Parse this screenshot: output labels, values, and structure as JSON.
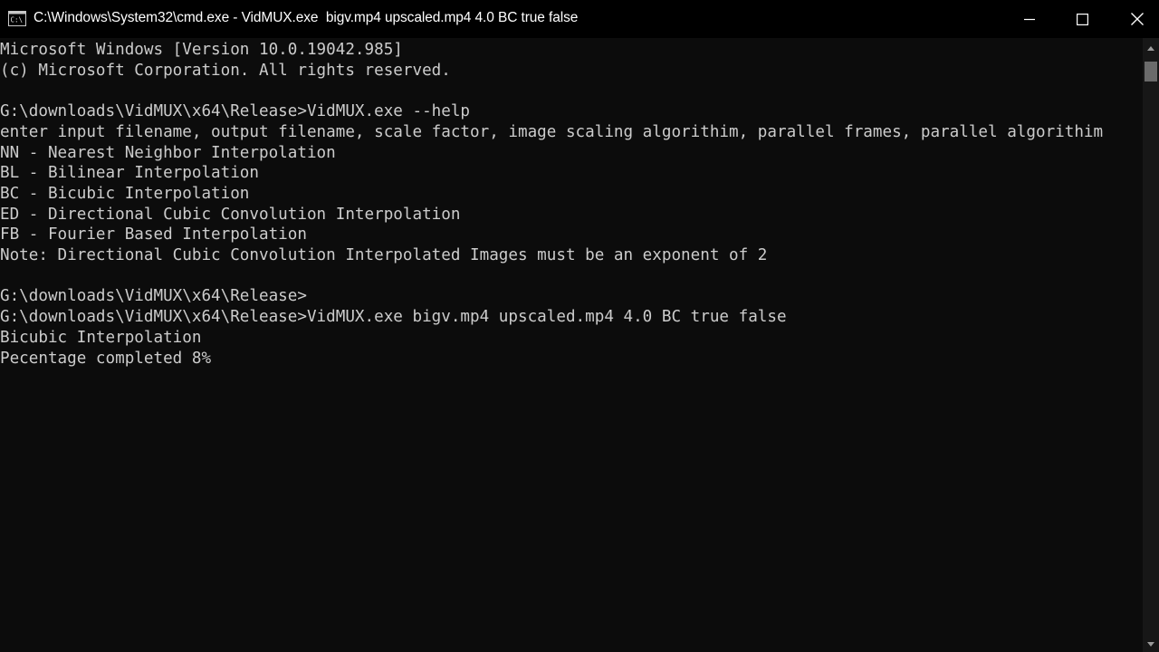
{
  "window": {
    "title": "C:\\Windows\\System32\\cmd.exe - VidMUX.exe  bigv.mp4 upscaled.mp4 4.0 BC true false",
    "icon": "cmd-icon",
    "controls": {
      "minimize_icon": "minimize-icon",
      "maximize_icon": "maximize-icon",
      "close_icon": "close-icon"
    }
  },
  "console": {
    "lines": [
      "Microsoft Windows [Version 10.0.19042.985]",
      "(c) Microsoft Corporation. All rights reserved.",
      "",
      "G:\\downloads\\VidMUX\\x64\\Release>VidMUX.exe --help",
      "enter input filename, output filename, scale factor, image scaling algorithim, parallel frames, parallel algorithim",
      "NN - Nearest Neighbor Interpolation",
      "BL - Bilinear Interpolation",
      "BC - Bicubic Interpolation",
      "ED - Directional Cubic Convolution Interpolation",
      "FB - Fourier Based Interpolation",
      "Note: Directional Cubic Convolution Interpolated Images must be an exponent of 2",
      "",
      "G:\\downloads\\VidMUX\\x64\\Release>",
      "G:\\downloads\\VidMUX\\x64\\Release>VidMUX.exe bigv.mp4 upscaled.mp4 4.0 BC true false",
      "Bicubic Interpolation",
      "Pecentage completed 8%"
    ]
  },
  "colors": {
    "background": "#0c0c0c",
    "titlebar": "#000000",
    "text": "#cccccc"
  }
}
